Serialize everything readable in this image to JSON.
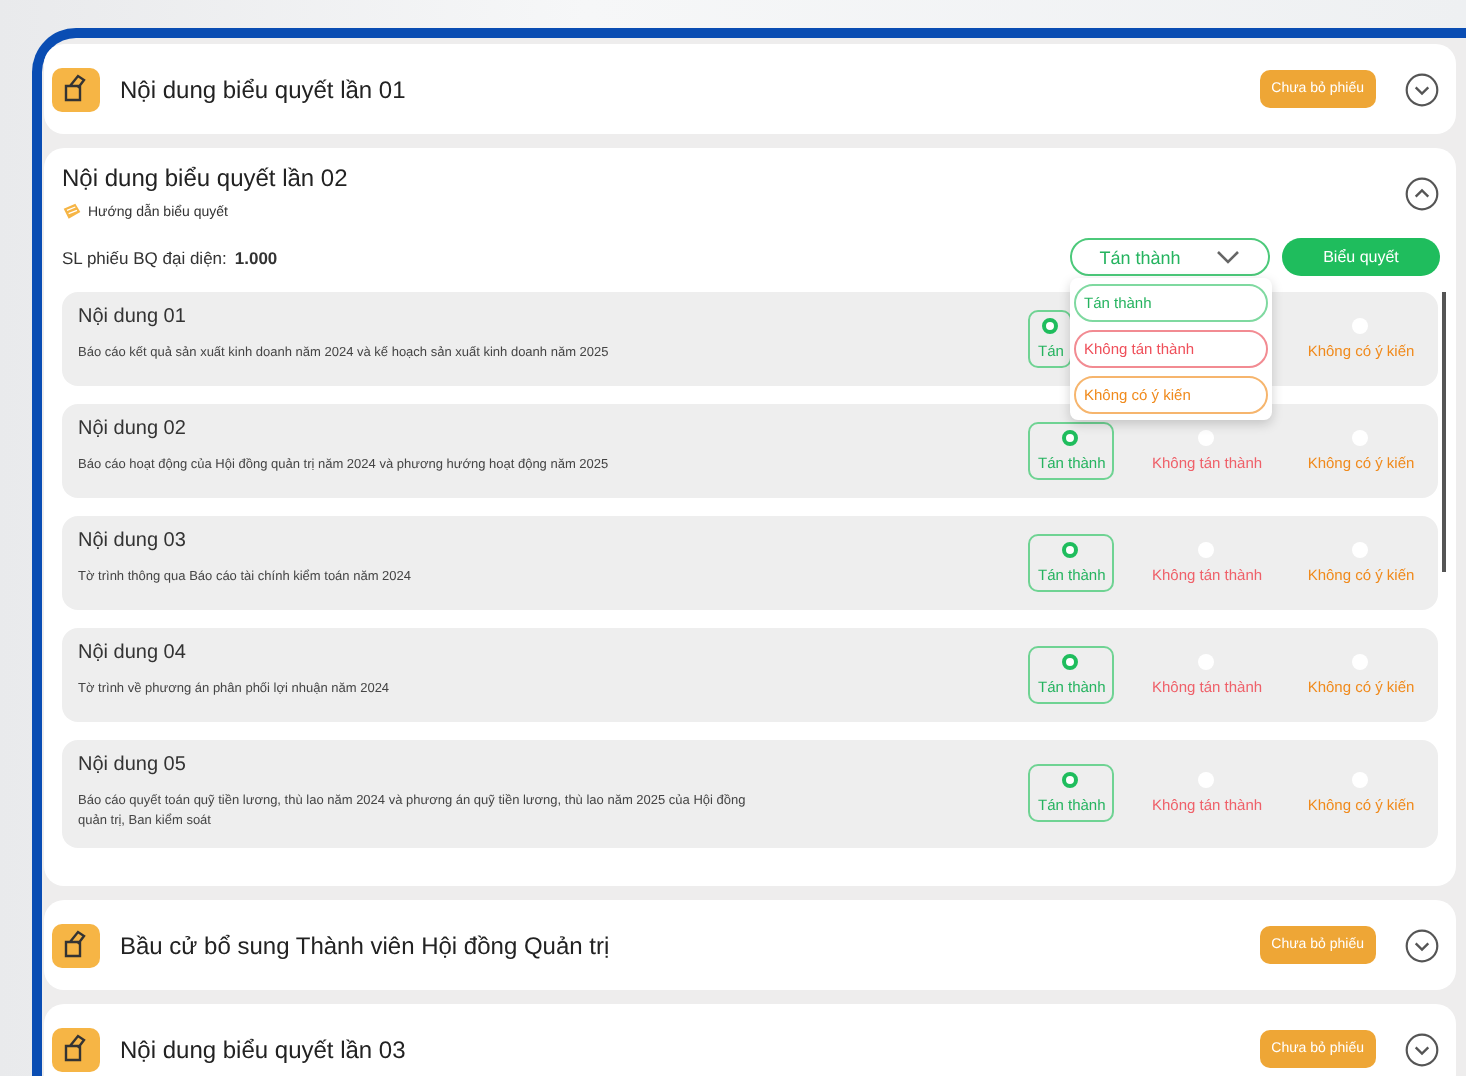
{
  "sections": [
    {
      "title": "Nội dung biểu quyết lần 01",
      "expanded": false,
      "status": "Chưa bỏ phiếu"
    },
    {
      "title": "Nội dung biểu quyết lần 02",
      "expanded": true,
      "guide": "Hướng dẫn biểu quyết",
      "count_label": "SL phiếu BQ đại diện:",
      "count_value": "1.000",
      "dropdown": {
        "value": "Tán thành",
        "open": true,
        "options": [
          {
            "label": "Tán thành",
            "kind": "agree"
          },
          {
            "label": "Không tán thành",
            "kind": "disagree"
          },
          {
            "label": "Không có ý kiến",
            "kind": "abstain"
          }
        ]
      },
      "submit": "Biểu quyết",
      "items": [
        {
          "title": "Nội dung 01",
          "description": "Báo cáo kết quả sản xuất kinh doanh năm 2024 và kế hoạch sản xuất kinh doanh năm 2025",
          "options": [
            {
              "label": "Tán",
              "kind": "agree",
              "selected": true
            },
            {
              "kind": "disagree"
            },
            {
              "label": "Không có ý kiến",
              "kind": "abstain",
              "selected": false
            }
          ]
        },
        {
          "title": "Nội dung 02",
          "description": "Báo cáo hoạt động của Hội đồng quản trị năm 2024 và phương hướng hoạt động năm 2025",
          "options": [
            {
              "label": "Tán thành",
              "kind": "agree",
              "selected": true
            },
            {
              "label": "Không tán thành",
              "kind": "disagree",
              "selected": false
            },
            {
              "label": "Không có ý kiến",
              "kind": "abstain",
              "selected": false
            }
          ]
        },
        {
          "title": "Nội dung 03",
          "description": "Tờ trình thông qua Báo cáo tài chính kiểm toán năm 2024",
          "options": [
            {
              "label": "Tán thành",
              "kind": "agree",
              "selected": true
            },
            {
              "label": "Không tán thành",
              "kind": "disagree",
              "selected": false
            },
            {
              "label": "Không có ý kiến",
              "kind": "abstain",
              "selected": false
            }
          ]
        },
        {
          "title": "Nội dung 04",
          "description": "Tờ trình về phương án phân phối lợi nhuận năm 2024",
          "options": [
            {
              "label": "Tán thành",
              "kind": "agree",
              "selected": true
            },
            {
              "label": "Không tán thành",
              "kind": "disagree",
              "selected": false
            },
            {
              "label": "Không có ý kiến",
              "kind": "abstain",
              "selected": false
            }
          ]
        },
        {
          "title": "Nội dung 05",
          "description": "Báo cáo quyết toán quỹ tiền lương, thù lao năm 2024 và phương án quỹ tiền lương, thù lao năm 2025 của Hội đồng quản trị, Ban kiểm soát",
          "options": [
            {
              "label": "Tán thành",
              "kind": "agree",
              "selected": true
            },
            {
              "label": "Không tán thành",
              "kind": "disagree",
              "selected": false
            },
            {
              "label": "Không có ý kiến",
              "kind": "abstain",
              "selected": false
            }
          ]
        }
      ]
    },
    {
      "title": "Bầu cử bổ sung Thành viên Hội đồng Quản trị",
      "expanded": false,
      "status": "Chưa bỏ phiếu"
    },
    {
      "title": "Nội dung biểu quyết lần 03",
      "expanded": false,
      "status": "Chưa bỏ phiếu"
    }
  ]
}
